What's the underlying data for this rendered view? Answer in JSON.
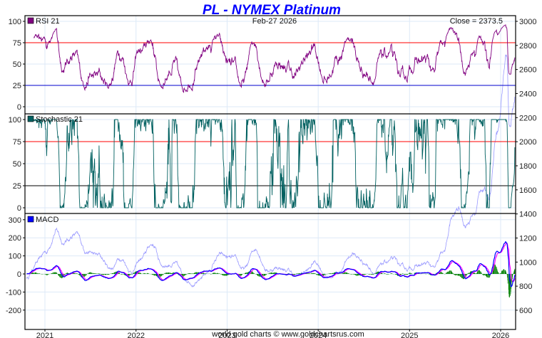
{
  "chart_data": {
    "type": "line",
    "title": "PL  -  NYMEX Platinum",
    "date_label": "Feb-27  2026",
    "close_label": "Close = 2373.5",
    "footer": "world gold charts © www.goldchartsrus.com",
    "x_ticks": [
      "2021",
      "2022",
      "2023",
      "2024",
      "2025",
      "2026"
    ],
    "price_axis": {
      "ticks": [
        "3000",
        "2800",
        "2600",
        "2400",
        "2200",
        "2000",
        "1800",
        "1600",
        "1400",
        "1200",
        "1000",
        "800",
        "600"
      ],
      "range": [
        600,
        3000
      ]
    },
    "panels": [
      {
        "name": "RSI 21",
        "ticks": [
          "100",
          "75",
          "50",
          "25",
          "0"
        ],
        "range": [
          0,
          100
        ],
        "upper": 75,
        "lower": 25,
        "color": "#800080"
      },
      {
        "name": "Stochastic 21",
        "ticks": [
          "100",
          "75",
          "50",
          "25",
          "0"
        ],
        "range": [
          0,
          100
        ],
        "upper": 75,
        "lower": 25,
        "color": "#006060"
      },
      {
        "name": "MACD",
        "ticks": [
          "300",
          "200",
          "100",
          "0",
          "-100",
          "-200"
        ],
        "range": [
          -230,
          330
        ],
        "color": "#0000ff",
        "signal_color": "#ff00ff",
        "hist_color": "#008000"
      }
    ],
    "price_series": {
      "name": "PL close",
      "color": "#9999ff",
      "monthly_approx": [
        [
          "2020-10-20",
          870
        ],
        [
          "2020-12-01",
          1000
        ],
        [
          "2021-01-05",
          1080
        ],
        [
          "2021-02-15",
          1270
        ],
        [
          "2021-03-15",
          1170
        ],
        [
          "2021-05-01",
          1230
        ],
        [
          "2021-06-15",
          1100
        ],
        [
          "2021-08-01",
          1050
        ],
        [
          "2021-09-20",
          950
        ],
        [
          "2021-11-01",
          1040
        ],
        [
          "2021-12-15",
          930
        ],
        [
          "2022-01-20",
          1020
        ],
        [
          "2022-03-08",
          1150
        ],
        [
          "2022-04-15",
          980
        ],
        [
          "2022-06-01",
          990
        ],
        [
          "2022-07-20",
          860
        ],
        [
          "2022-09-01",
          830
        ],
        [
          "2022-10-15",
          920
        ],
        [
          "2022-12-01",
          1050
        ],
        [
          "2023-01-20",
          1020
        ],
        [
          "2023-03-10",
          930
        ],
        [
          "2023-04-25",
          1110
        ],
        [
          "2023-06-15",
          940
        ],
        [
          "2023-07-25",
          960
        ],
        [
          "2023-09-01",
          930
        ],
        [
          "2023-10-05",
          880
        ],
        [
          "2023-11-20",
          930
        ],
        [
          "2023-12-20",
          1000
        ],
        [
          "2024-02-10",
          880
        ],
        [
          "2024-03-15",
          910
        ],
        [
          "2024-05-20",
          1070
        ],
        [
          "2024-07-01",
          1000
        ],
        [
          "2024-08-10",
          930
        ],
        [
          "2024-10-20",
          1010
        ],
        [
          "2024-12-15",
          935
        ],
        [
          "2025-02-01",
          970
        ],
        [
          "2025-03-15",
          980
        ],
        [
          "2025-04-10",
          940
        ],
        [
          "2025-05-20",
          1080
        ],
        [
          "2025-06-20",
          1350
        ],
        [
          "2025-07-15",
          1430
        ],
        [
          "2025-08-15",
          1320
        ],
        [
          "2025-09-20",
          1400
        ],
        [
          "2025-10-15",
          1620
        ],
        [
          "2025-11-15",
          1560
        ],
        [
          "2025-12-20",
          2150
        ],
        [
          "2026-01-25",
          2750
        ],
        [
          "2026-02-05",
          2100
        ],
        [
          "2026-02-27",
          2373.5
        ]
      ]
    }
  }
}
